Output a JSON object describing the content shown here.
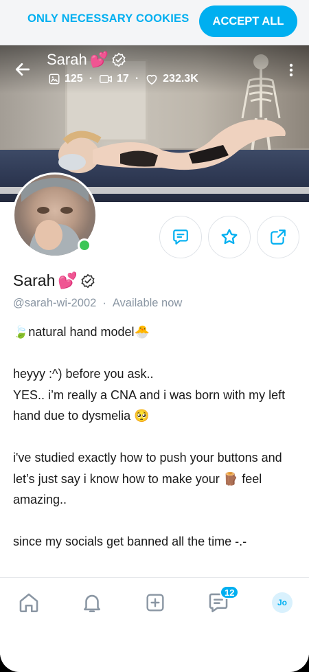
{
  "cookie_bar": {
    "necessary_label": "ONLY NECESSARY COOKIES",
    "accept_label": "ACCEPT ALL"
  },
  "cover": {
    "name": "Sarah",
    "name_emoji": "💕",
    "stats": {
      "photos": "125",
      "videos": "17",
      "likes": "232.3K"
    }
  },
  "profile": {
    "name": "Sarah",
    "name_emoji": "💕",
    "handle": "@sarah-wi-2002",
    "separator": "·",
    "status": "Available now",
    "bio": "🍃natural hand model🐣\n\nheyyy :^) before you ask..\nYES.. i’m really a CNA and i was born with my left\nhand due to dysmelia 🥺\n\ni've studied exactly how to push your buttons and let’s just say i know how to make your 🪵 feel amazing..\n\nsince my socials get banned all the time -.-"
  },
  "bottom_nav": {
    "messages_badge": "12",
    "user_initials": "Jo"
  },
  "colors": {
    "accent": "#00aff0",
    "online": "#3cc656",
    "muted_text": "#8a96a3"
  },
  "icons": [
    "back-arrow-icon",
    "verified-icon",
    "image-icon",
    "video-icon",
    "heart-icon",
    "more-vertical-icon",
    "message-icon",
    "star-icon",
    "share-icon",
    "home-icon",
    "bell-icon",
    "add-square-icon",
    "chat-icon"
  ]
}
